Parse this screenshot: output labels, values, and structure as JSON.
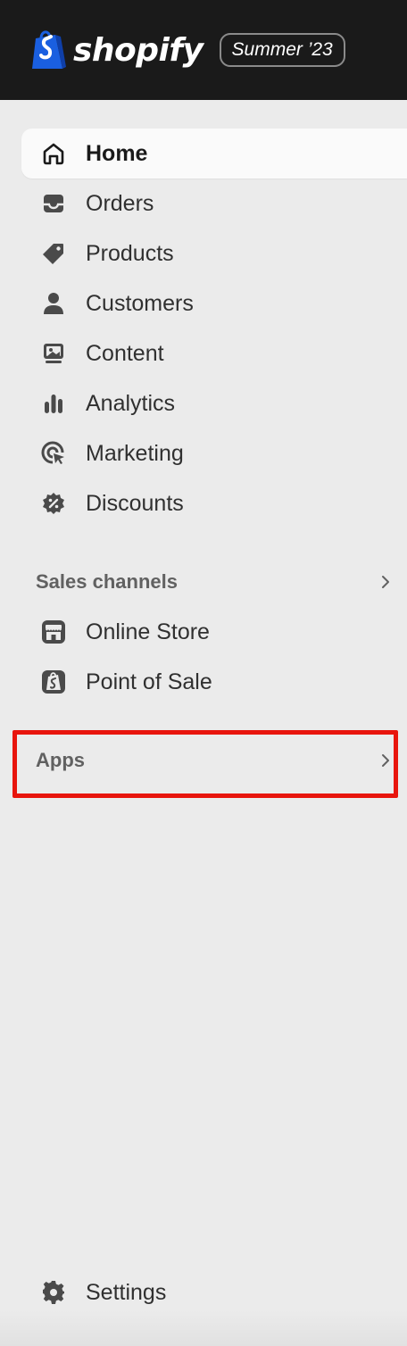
{
  "header": {
    "brand": "shopify",
    "edition": "Summer ’23",
    "logo_icon": "shopify-bag-icon"
  },
  "colors": {
    "header_bg": "#1a1a1a",
    "sidebar_bg": "#ebebeb",
    "active_bg": "#fafafa",
    "logo_green": "#5e8e3e",
    "highlight": "#e8150d"
  },
  "nav": {
    "items": [
      {
        "label": "Home",
        "icon": "home-icon",
        "active": true
      },
      {
        "label": "Orders",
        "icon": "inbox-icon",
        "active": false
      },
      {
        "label": "Products",
        "icon": "tag-icon",
        "active": false
      },
      {
        "label": "Customers",
        "icon": "person-icon",
        "active": false
      },
      {
        "label": "Content",
        "icon": "image-icon",
        "active": false
      },
      {
        "label": "Analytics",
        "icon": "bar-chart-icon",
        "active": false
      },
      {
        "label": "Marketing",
        "icon": "target-icon",
        "active": false
      },
      {
        "label": "Discounts",
        "icon": "discount-badge-icon",
        "active": false
      }
    ]
  },
  "sales_channels": {
    "title": "Sales channels",
    "items": [
      {
        "label": "Online Store",
        "icon": "storefront-icon"
      },
      {
        "label": "Point of Sale",
        "icon": "pos-bag-icon"
      }
    ]
  },
  "apps": {
    "title": "Apps"
  },
  "settings": {
    "label": "Settings",
    "icon": "gear-icon"
  }
}
